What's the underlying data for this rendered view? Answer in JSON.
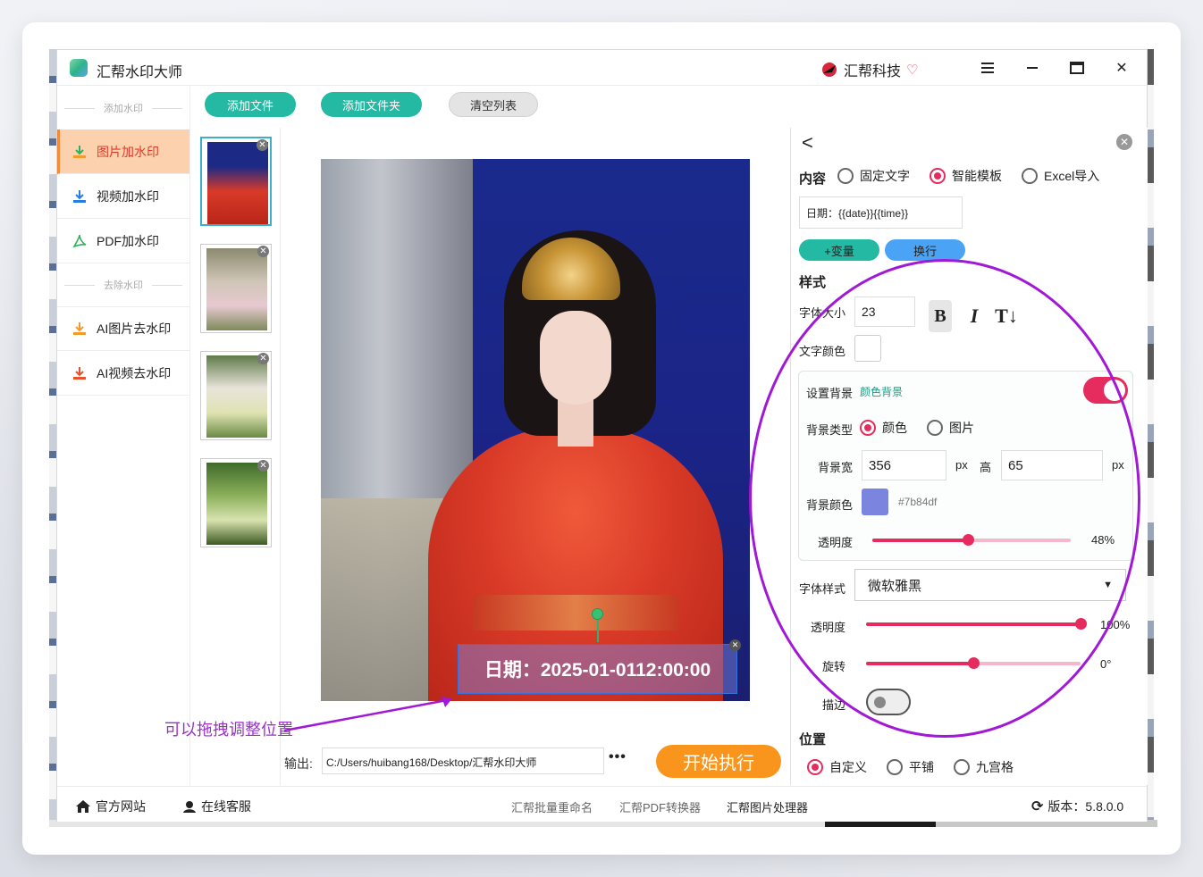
{
  "app": {
    "title": "汇帮水印大师",
    "brand": "汇帮科技"
  },
  "sidebar": {
    "section_add": "添加水印",
    "items_add": [
      {
        "label": "图片加水印",
        "icon": "download-icon",
        "active": true
      },
      {
        "label": "视频加水印",
        "icon": "download-icon",
        "active": false
      },
      {
        "label": "PDF加水印",
        "icon": "pdf-icon",
        "active": false
      }
    ],
    "section_remove": "去除水印",
    "items_remove": [
      {
        "label": "AI图片去水印",
        "icon": "download-icon"
      },
      {
        "label": "AI视频去水印",
        "icon": "download-icon"
      }
    ]
  },
  "toolbar": {
    "add_file": "添加文件",
    "add_folder": "添加文件夹",
    "clear_list": "清空列表"
  },
  "preview": {
    "watermark_text": "日期：2025-01-0112:00:00",
    "drag_hint": "可以拖拽调整位置"
  },
  "output": {
    "label": "输出:",
    "path": "C:/Users/huibang168/Desktop/汇帮水印大师",
    "more": "•••",
    "start": "开始执行"
  },
  "panel": {
    "content_label": "内容",
    "content_options": [
      "固定文字",
      "智能模板",
      "Excel导入"
    ],
    "content_selected": "智能模板",
    "template_text": "日期：{{date}}{{time}}",
    "add_var": "+变量",
    "newline": "换行",
    "style_label": "样式",
    "font_size_label": "字体大小",
    "font_size": "23",
    "bold": "B",
    "italic": "I",
    "text_format": "T↓",
    "text_color_label": "文字颜色",
    "bg": {
      "label": "设置背景",
      "mode": "颜色背景",
      "enabled": true,
      "type_label": "背景类型",
      "type_options": [
        "颜色",
        "图片"
      ],
      "type_selected": "颜色",
      "width_label": "背景宽",
      "width": "356",
      "height_label": "高",
      "height": "65",
      "unit": "px",
      "color_label": "背景颜色",
      "color": "#7b84df",
      "opacity_label": "透明度",
      "opacity_value": "48%",
      "opacity_fraction": 0.48
    },
    "font_style_label": "字体样式",
    "font_style": "微软雅黑",
    "opacity_label": "透明度",
    "opacity_value": "100%",
    "opacity_fraction": 1.0,
    "rotate_label": "旋转",
    "rotate_value": "0°",
    "rotate_fraction": 0.5,
    "stroke_label": "描边",
    "stroke_enabled": false,
    "position_label": "位置",
    "position_options": [
      "自定义",
      "平铺",
      "九宫格"
    ],
    "position_selected": "自定义"
  },
  "footer": {
    "website": "官方网站",
    "support": "在线客服",
    "links": [
      "汇帮批量重命名",
      "汇帮PDF转换器",
      "汇帮图片处理器"
    ],
    "version": "版本：5.8.0.0"
  },
  "colors": {
    "accent": "#e62b5e",
    "green": "#23b9a2",
    "orange": "#f9951c",
    "annotation": "#a118d6"
  }
}
